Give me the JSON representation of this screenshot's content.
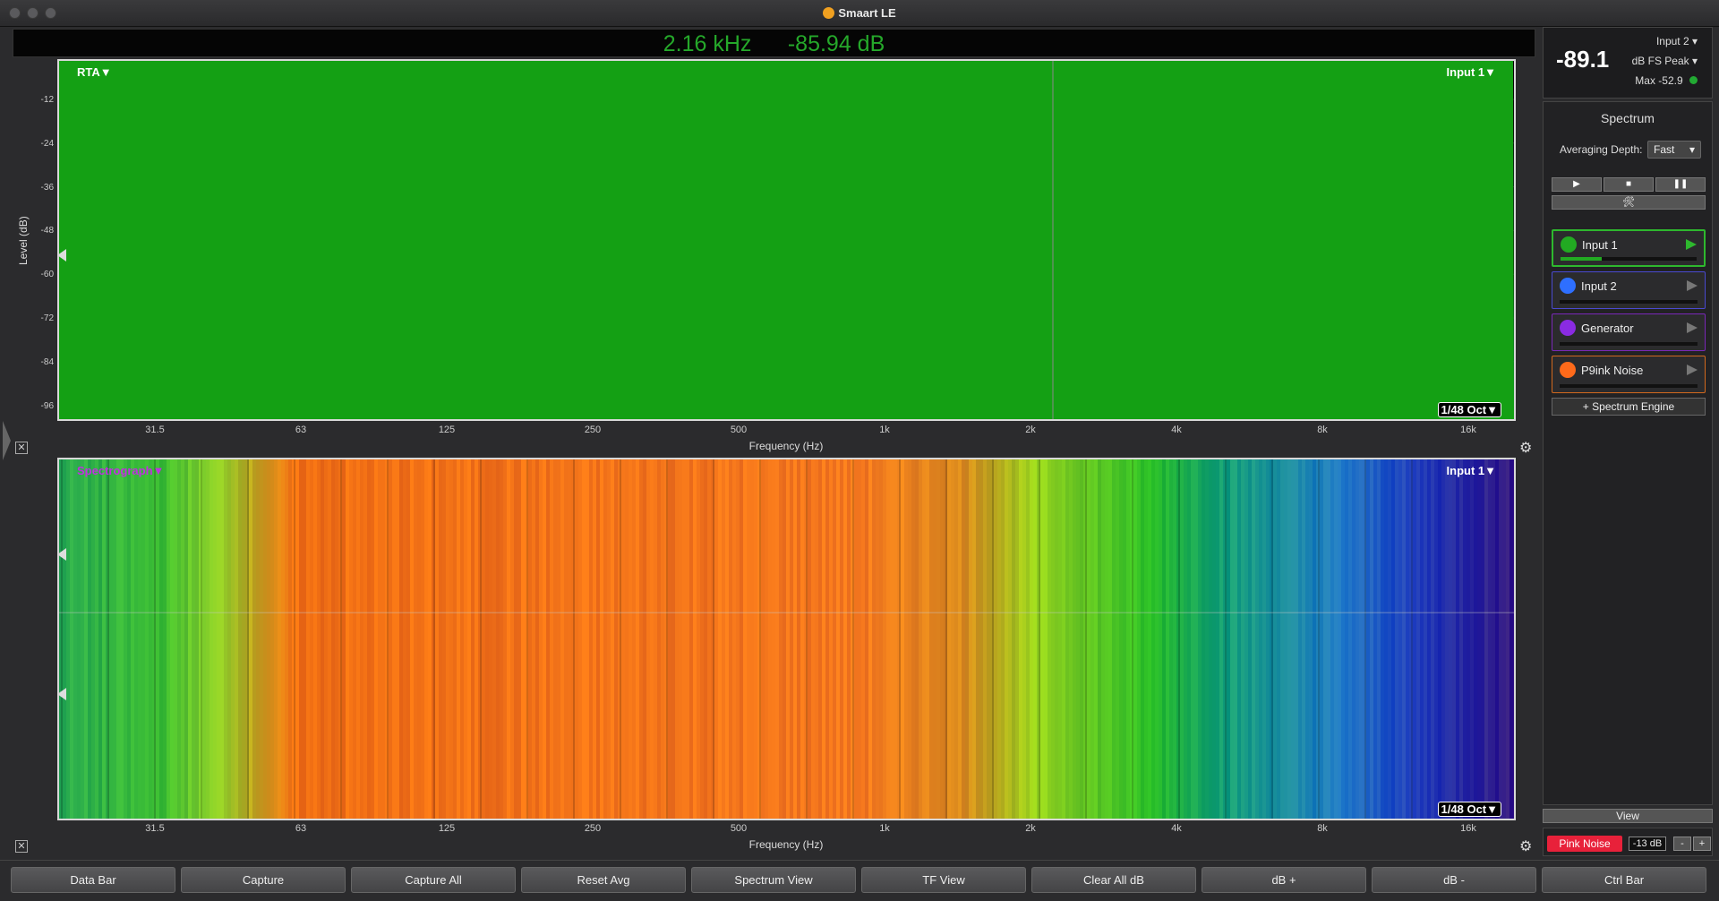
{
  "window": {
    "title": "Smaart LE"
  },
  "readout": {
    "freq": "2.16 kHz",
    "level": "-85.94 dB"
  },
  "rta": {
    "label": "RTA▼",
    "input": "Input 1▼",
    "octave": "1/48 Oct▼",
    "ylabel": "Level (dB)",
    "yticks": [
      "-12",
      "-24",
      "-36",
      "-48",
      "-60",
      "-72",
      "-84",
      "-96"
    ],
    "xlabel": "Frequency (Hz)",
    "xticks": [
      "31.5",
      "63",
      "125",
      "250",
      "500",
      "1k",
      "2k",
      "4k",
      "8k",
      "16k"
    ]
  },
  "spectrograph": {
    "label": "Spectrograph▼",
    "input": "Input 1▼",
    "octave": "1/48 Oct▼",
    "xlabel": "Frequency (Hz)",
    "xticks": [
      "31.5",
      "63",
      "125",
      "250",
      "500",
      "1k",
      "2k",
      "4k",
      "8k",
      "16k"
    ]
  },
  "meter": {
    "value": "-89.1",
    "input": "Input 2",
    "mode": "dB FS Peak",
    "max": "Max -52.9",
    "max_color": "#22aa33"
  },
  "panel": {
    "title": "Spectrum",
    "avg_label": "Averaging Depth:",
    "avg_value": "Fast",
    "transport": [
      "▶",
      "■",
      "❚❚"
    ],
    "tools": "🛠",
    "engines": [
      {
        "name": "Input 1",
        "color": "#22aa22",
        "border": "#2eb82e"
      },
      {
        "name": "Input 2",
        "color": "#2e6fff",
        "border": "#4a4ad0"
      },
      {
        "name": "Generator",
        "color": "#8a2be2",
        "border": "#7a28b8"
      },
      {
        "name": "P9ink Noise",
        "color": "#ff6a1a",
        "border": "#d2691e"
      }
    ],
    "add_engine": "+ Spectrum Engine"
  },
  "view_button": "View",
  "pink_noise": {
    "label": "Pink Noise",
    "level": "-13 dB",
    "minus": "-",
    "plus": "+"
  },
  "bottombar": [
    "Data Bar",
    "Capture",
    "Capture All",
    "Reset Avg",
    "Spectrum View",
    "TF View",
    "Clear All dB",
    "dB +",
    "dB -",
    "Ctrl Bar"
  ],
  "icons": {
    "close_small": "close-icon",
    "gear": "gear-icon"
  },
  "colors": {
    "rta_green": "#14a014",
    "rta_blue": "#0b4aa0",
    "readout": "#25a82a"
  }
}
